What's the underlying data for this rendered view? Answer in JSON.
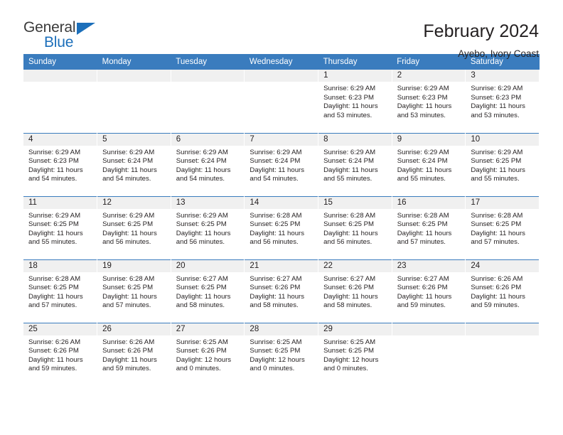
{
  "brand": {
    "name_top": "General",
    "name_bottom": "Blue",
    "accent_color": "#1c6fba"
  },
  "header": {
    "title": "February 2024",
    "subtitle": "Ayebo, Ivory Coast"
  },
  "calendar": {
    "header_bg": "#3a7cbe",
    "daynum_bg": "#f0f0f0",
    "weekdays": [
      "Sunday",
      "Monday",
      "Tuesday",
      "Wednesday",
      "Thursday",
      "Friday",
      "Saturday"
    ],
    "weeks": [
      [
        {
          "day": "",
          "empty": true
        },
        {
          "day": "",
          "empty": true
        },
        {
          "day": "",
          "empty": true
        },
        {
          "day": "",
          "empty": true
        },
        {
          "day": "1",
          "sunrise": "Sunrise: 6:29 AM",
          "sunset": "Sunset: 6:23 PM",
          "daylight1": "Daylight: 11 hours",
          "daylight2": "and 53 minutes."
        },
        {
          "day": "2",
          "sunrise": "Sunrise: 6:29 AM",
          "sunset": "Sunset: 6:23 PM",
          "daylight1": "Daylight: 11 hours",
          "daylight2": "and 53 minutes."
        },
        {
          "day": "3",
          "sunrise": "Sunrise: 6:29 AM",
          "sunset": "Sunset: 6:23 PM",
          "daylight1": "Daylight: 11 hours",
          "daylight2": "and 53 minutes."
        }
      ],
      [
        {
          "day": "4",
          "sunrise": "Sunrise: 6:29 AM",
          "sunset": "Sunset: 6:23 PM",
          "daylight1": "Daylight: 11 hours",
          "daylight2": "and 54 minutes."
        },
        {
          "day": "5",
          "sunrise": "Sunrise: 6:29 AM",
          "sunset": "Sunset: 6:24 PM",
          "daylight1": "Daylight: 11 hours",
          "daylight2": "and 54 minutes."
        },
        {
          "day": "6",
          "sunrise": "Sunrise: 6:29 AM",
          "sunset": "Sunset: 6:24 PM",
          "daylight1": "Daylight: 11 hours",
          "daylight2": "and 54 minutes."
        },
        {
          "day": "7",
          "sunrise": "Sunrise: 6:29 AM",
          "sunset": "Sunset: 6:24 PM",
          "daylight1": "Daylight: 11 hours",
          "daylight2": "and 54 minutes."
        },
        {
          "day": "8",
          "sunrise": "Sunrise: 6:29 AM",
          "sunset": "Sunset: 6:24 PM",
          "daylight1": "Daylight: 11 hours",
          "daylight2": "and 55 minutes."
        },
        {
          "day": "9",
          "sunrise": "Sunrise: 6:29 AM",
          "sunset": "Sunset: 6:24 PM",
          "daylight1": "Daylight: 11 hours",
          "daylight2": "and 55 minutes."
        },
        {
          "day": "10",
          "sunrise": "Sunrise: 6:29 AM",
          "sunset": "Sunset: 6:25 PM",
          "daylight1": "Daylight: 11 hours",
          "daylight2": "and 55 minutes."
        }
      ],
      [
        {
          "day": "11",
          "sunrise": "Sunrise: 6:29 AM",
          "sunset": "Sunset: 6:25 PM",
          "daylight1": "Daylight: 11 hours",
          "daylight2": "and 55 minutes."
        },
        {
          "day": "12",
          "sunrise": "Sunrise: 6:29 AM",
          "sunset": "Sunset: 6:25 PM",
          "daylight1": "Daylight: 11 hours",
          "daylight2": "and 56 minutes."
        },
        {
          "day": "13",
          "sunrise": "Sunrise: 6:29 AM",
          "sunset": "Sunset: 6:25 PM",
          "daylight1": "Daylight: 11 hours",
          "daylight2": "and 56 minutes."
        },
        {
          "day": "14",
          "sunrise": "Sunrise: 6:28 AM",
          "sunset": "Sunset: 6:25 PM",
          "daylight1": "Daylight: 11 hours",
          "daylight2": "and 56 minutes."
        },
        {
          "day": "15",
          "sunrise": "Sunrise: 6:28 AM",
          "sunset": "Sunset: 6:25 PM",
          "daylight1": "Daylight: 11 hours",
          "daylight2": "and 56 minutes."
        },
        {
          "day": "16",
          "sunrise": "Sunrise: 6:28 AM",
          "sunset": "Sunset: 6:25 PM",
          "daylight1": "Daylight: 11 hours",
          "daylight2": "and 57 minutes."
        },
        {
          "day": "17",
          "sunrise": "Sunrise: 6:28 AM",
          "sunset": "Sunset: 6:25 PM",
          "daylight1": "Daylight: 11 hours",
          "daylight2": "and 57 minutes."
        }
      ],
      [
        {
          "day": "18",
          "sunrise": "Sunrise: 6:28 AM",
          "sunset": "Sunset: 6:25 PM",
          "daylight1": "Daylight: 11 hours",
          "daylight2": "and 57 minutes."
        },
        {
          "day": "19",
          "sunrise": "Sunrise: 6:28 AM",
          "sunset": "Sunset: 6:25 PM",
          "daylight1": "Daylight: 11 hours",
          "daylight2": "and 57 minutes."
        },
        {
          "day": "20",
          "sunrise": "Sunrise: 6:27 AM",
          "sunset": "Sunset: 6:25 PM",
          "daylight1": "Daylight: 11 hours",
          "daylight2": "and 58 minutes."
        },
        {
          "day": "21",
          "sunrise": "Sunrise: 6:27 AM",
          "sunset": "Sunset: 6:26 PM",
          "daylight1": "Daylight: 11 hours",
          "daylight2": "and 58 minutes."
        },
        {
          "day": "22",
          "sunrise": "Sunrise: 6:27 AM",
          "sunset": "Sunset: 6:26 PM",
          "daylight1": "Daylight: 11 hours",
          "daylight2": "and 58 minutes."
        },
        {
          "day": "23",
          "sunrise": "Sunrise: 6:27 AM",
          "sunset": "Sunset: 6:26 PM",
          "daylight1": "Daylight: 11 hours",
          "daylight2": "and 59 minutes."
        },
        {
          "day": "24",
          "sunrise": "Sunrise: 6:26 AM",
          "sunset": "Sunset: 6:26 PM",
          "daylight1": "Daylight: 11 hours",
          "daylight2": "and 59 minutes."
        }
      ],
      [
        {
          "day": "25",
          "sunrise": "Sunrise: 6:26 AM",
          "sunset": "Sunset: 6:26 PM",
          "daylight1": "Daylight: 11 hours",
          "daylight2": "and 59 minutes."
        },
        {
          "day": "26",
          "sunrise": "Sunrise: 6:26 AM",
          "sunset": "Sunset: 6:26 PM",
          "daylight1": "Daylight: 11 hours",
          "daylight2": "and 59 minutes."
        },
        {
          "day": "27",
          "sunrise": "Sunrise: 6:25 AM",
          "sunset": "Sunset: 6:26 PM",
          "daylight1": "Daylight: 12 hours",
          "daylight2": "and 0 minutes."
        },
        {
          "day": "28",
          "sunrise": "Sunrise: 6:25 AM",
          "sunset": "Sunset: 6:25 PM",
          "daylight1": "Daylight: 12 hours",
          "daylight2": "and 0 minutes."
        },
        {
          "day": "29",
          "sunrise": "Sunrise: 6:25 AM",
          "sunset": "Sunset: 6:25 PM",
          "daylight1": "Daylight: 12 hours",
          "daylight2": "and 0 minutes."
        },
        {
          "day": "",
          "empty": true
        },
        {
          "day": "",
          "empty": true
        }
      ]
    ]
  }
}
